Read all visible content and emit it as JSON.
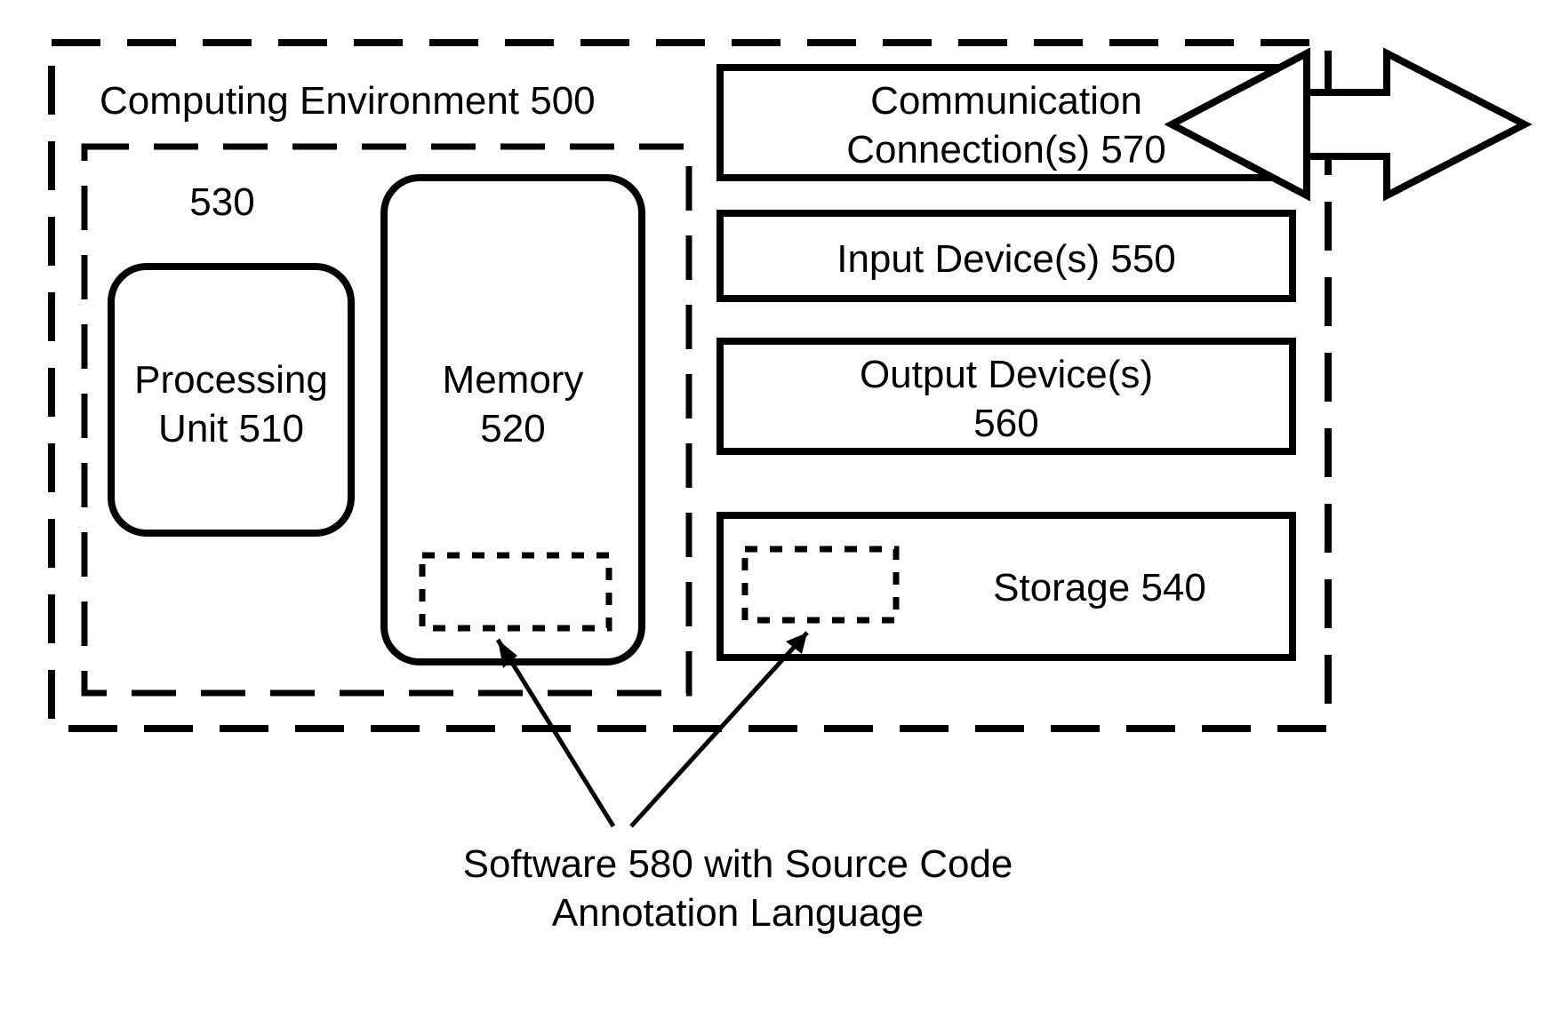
{
  "diagram": {
    "env_label": "Computing Environment 500",
    "inner_label": "530",
    "processing_unit_label": "Processing\nUnit 510",
    "memory_label": "Memory\n520",
    "comm_label": "Communication\nConnection(s) 570",
    "input_label": "Input Device(s) 550",
    "output_label": "Output Device(s)\n560",
    "storage_label": "Storage 540",
    "caption": "Software 580 with Source Code\nAnnotation Language"
  }
}
